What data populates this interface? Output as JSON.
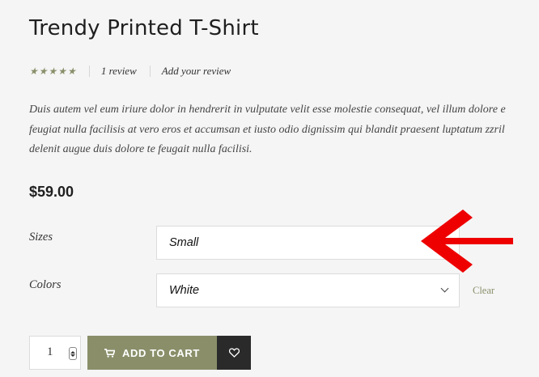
{
  "product": {
    "title": "Trendy Printed T-Shirt",
    "rating": 5,
    "review_count_label": "1 review",
    "add_review_label": "Add your review",
    "description": [
      "Duis autem vel eum iriure dolor in hendrerit in vulputate velit esse molestie consequat, vel illum dolore e",
      "feugiat nulla facilisis at vero eros et accumsan et iusto odio dignissim qui blandit praesent luptatum zzril",
      "delenit augue duis dolore te feugait nulla facilisi."
    ],
    "price": "$59.00"
  },
  "options": {
    "sizes_label": "Sizes",
    "sizes_value": "Small",
    "colors_label": "Colors",
    "colors_value": "White",
    "clear_label": "Clear"
  },
  "cart": {
    "quantity": "1",
    "add_to_cart_label": "ADD TO CART"
  },
  "colors": {
    "accent": "#8a8f6a",
    "dark": "#2a2a2a",
    "annotation_arrow": "#ee0000"
  },
  "icons": {
    "rating": "star-icon",
    "cart": "cart-icon",
    "wishlist": "heart-icon",
    "dropdown": "chevron-down-icon",
    "annotation": "arrow-left-icon"
  }
}
